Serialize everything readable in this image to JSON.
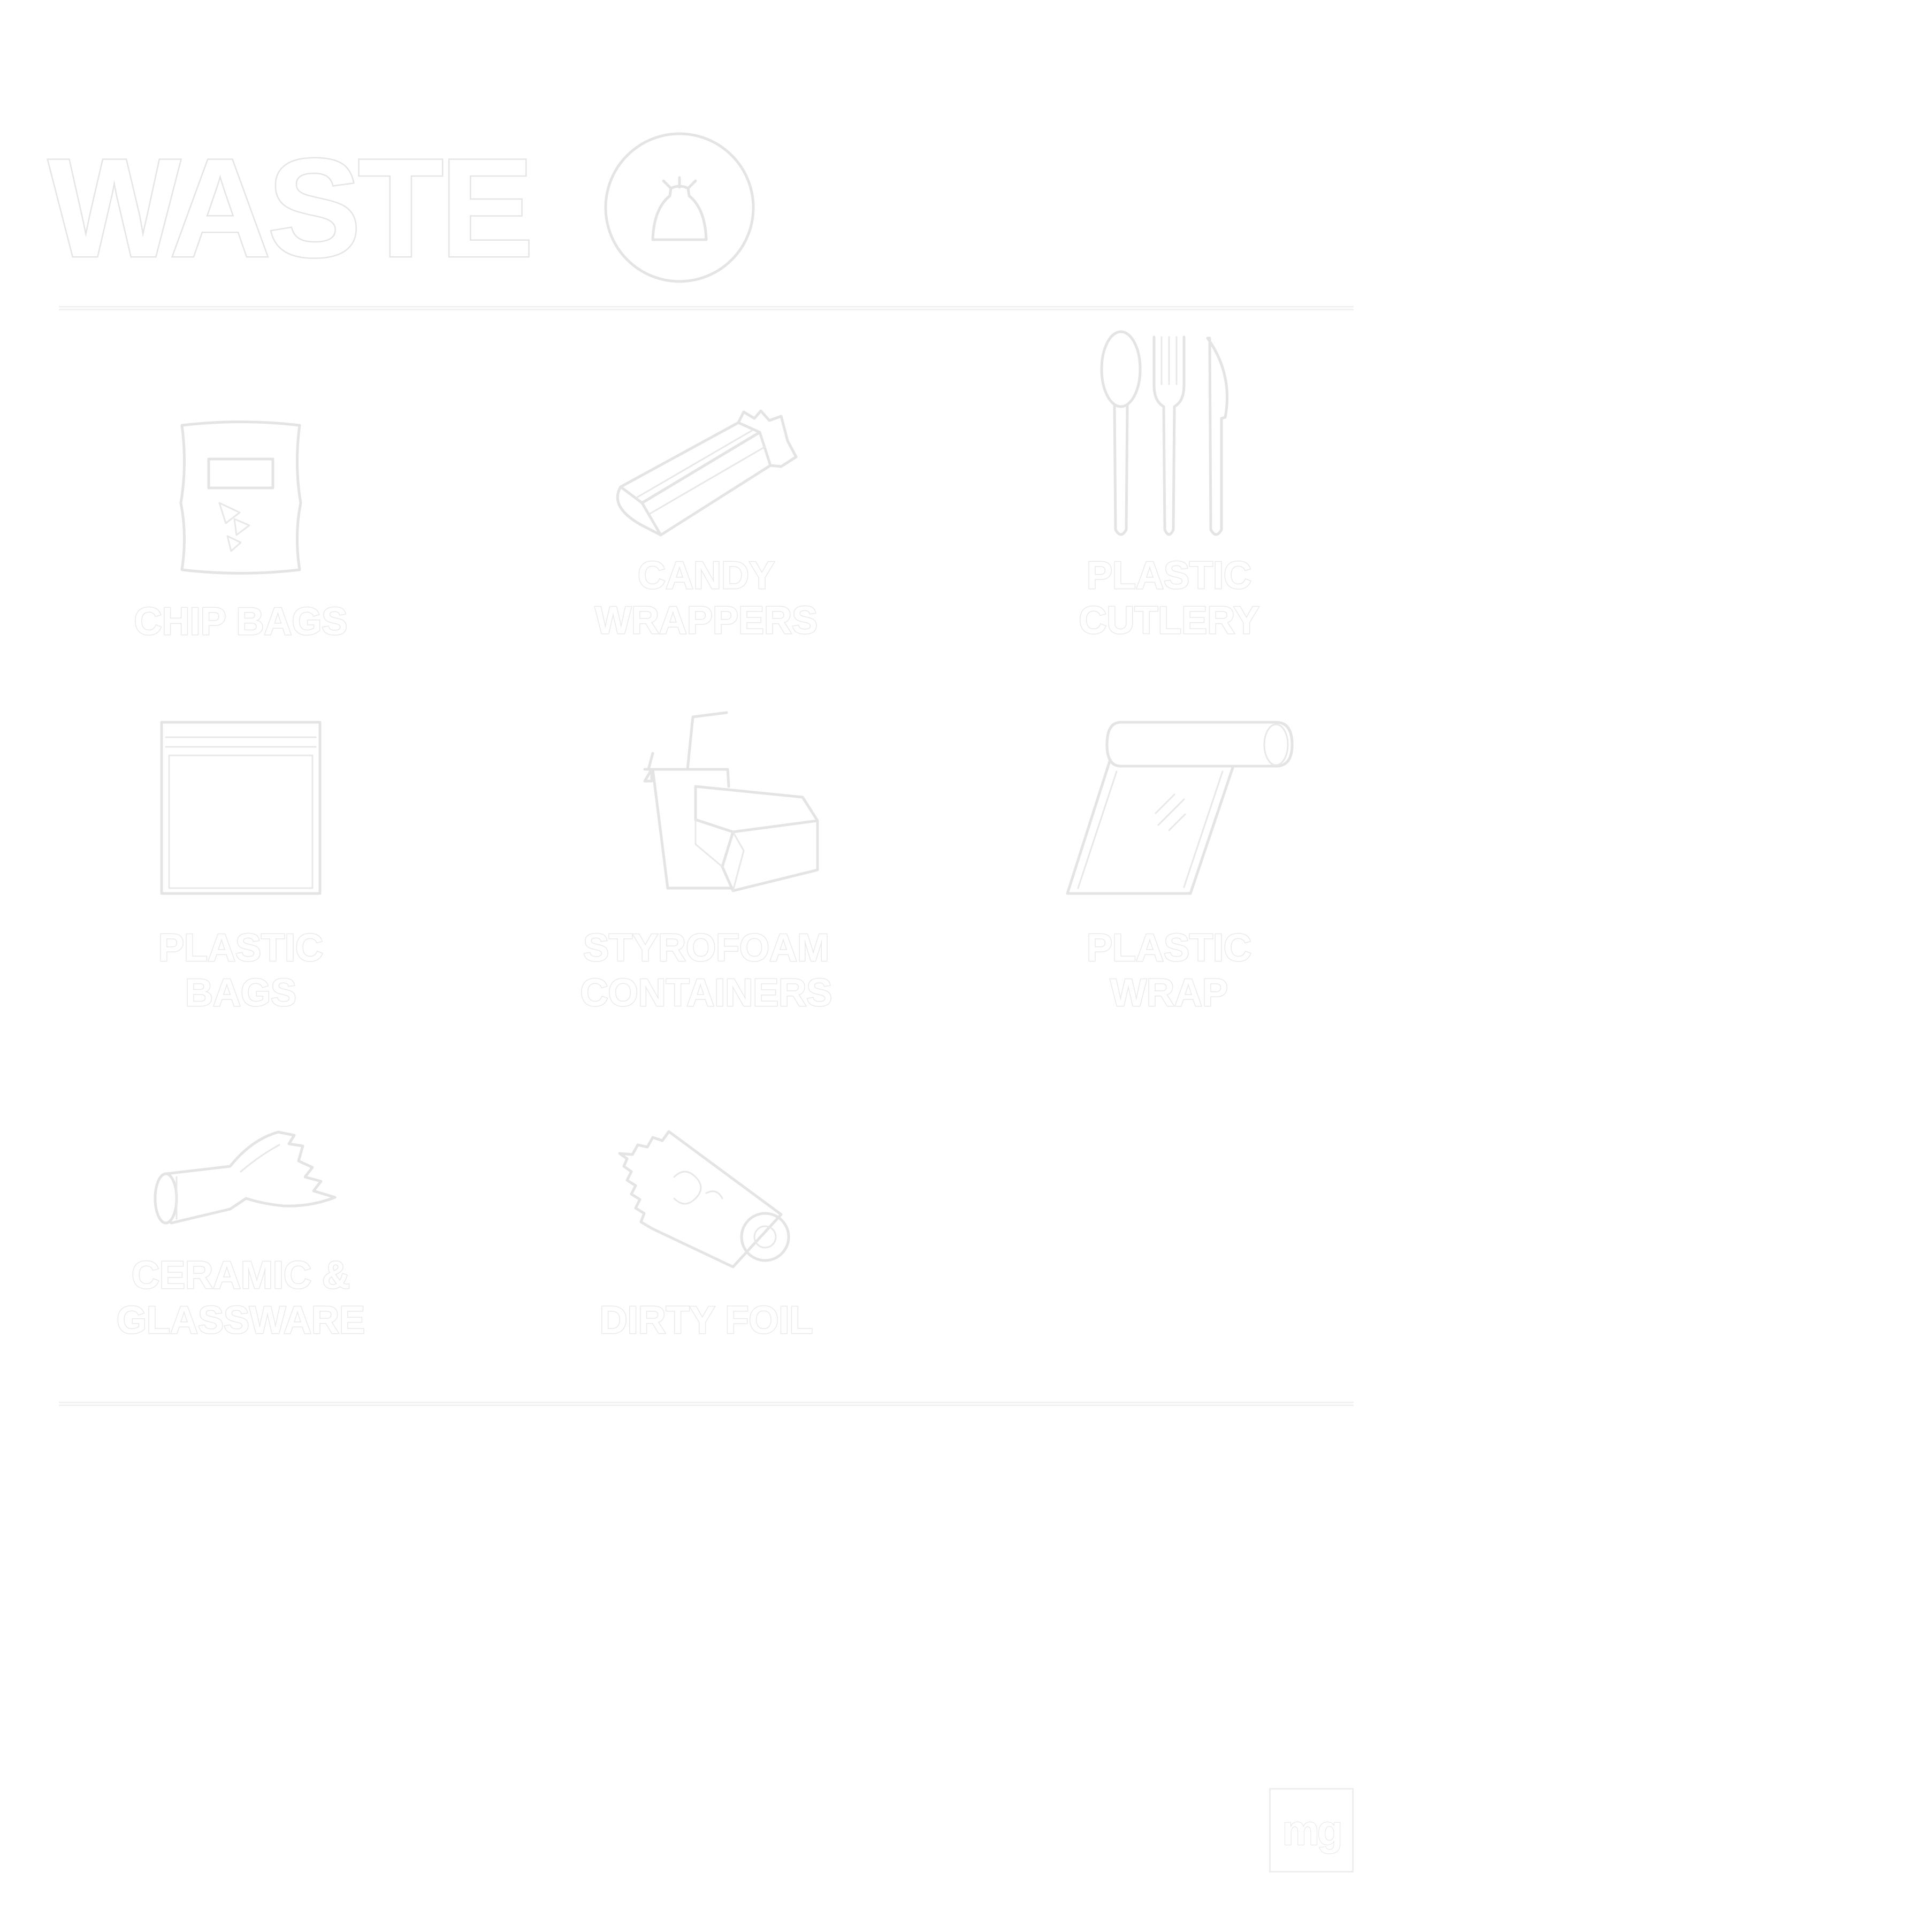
{
  "sign": {
    "title": "WASTE",
    "title_icon": "trash-bag-icon",
    "items": [
      {
        "icon": "chip-bag-icon",
        "label": "CHIP BAGS"
      },
      {
        "icon": "candy-wrapper-icon",
        "label": "CANDY\nWRAPPERS"
      },
      {
        "icon": "plastic-cutlery-icon",
        "label": "PLASTIC\nCUTLERY"
      },
      {
        "icon": "plastic-bag-icon",
        "label": "PLASTIC\nBAGS"
      },
      {
        "icon": "styrofoam-container-icon",
        "label": "STYROFOAM\nCONTAINERS"
      },
      {
        "icon": "plastic-wrap-icon",
        "label": "PLASTIC\nWRAP"
      },
      {
        "icon": "broken-glass-bottle-icon",
        "label": "CERAMIC &\nGLASSWARE"
      },
      {
        "icon": "dirty-foil-icon",
        "label": "DIRTY FOIL"
      }
    ],
    "logo": {
      "text": "mg"
    },
    "colors": {
      "background": "#ffffff",
      "ink": "#ffffff",
      "outline": "#e6e6e6"
    }
  }
}
